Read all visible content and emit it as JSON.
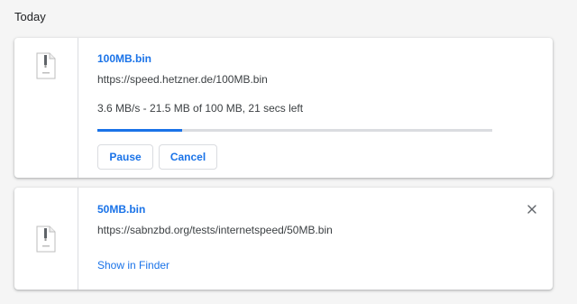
{
  "section": {
    "title": "Today"
  },
  "downloads": [
    {
      "filename": "100MB.bin",
      "url": "https://speed.hetzner.de/100MB.bin",
      "status": "3.6 MB/s - 21.5 MB of 100 MB, 21 secs left",
      "progress": 0.215,
      "pause_label": "Pause",
      "cancel_label": "Cancel"
    },
    {
      "filename": "50MB.bin",
      "url": "https://sabnzbd.org/tests/internetspeed/50MB.bin",
      "show_in_finder_label": "Show in Finder",
      "close_icon": "close-icon"
    }
  ],
  "colors": {
    "accent": "#1a73e8",
    "track": "#dadce0",
    "background": "#f5f5f5"
  },
  "icons": {
    "file": "document-file-icon"
  }
}
